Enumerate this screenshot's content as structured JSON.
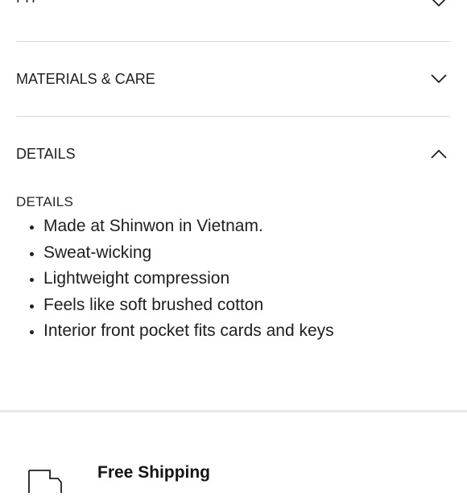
{
  "accordion": {
    "fit": {
      "label": "FIT"
    },
    "materials": {
      "label": "MATERIALS & CARE"
    },
    "details": {
      "label": "DETAILS",
      "subheading": "DETAILS",
      "items": [
        "Made at Shinwon in Vietnam.",
        "Sweat-wicking",
        "Lightweight compression",
        "Feels like soft brushed cotton",
        "Interior front pocket fits cards and keys"
      ]
    }
  },
  "shipping": {
    "title": "Free Shipping",
    "icon": "box-icon"
  }
}
